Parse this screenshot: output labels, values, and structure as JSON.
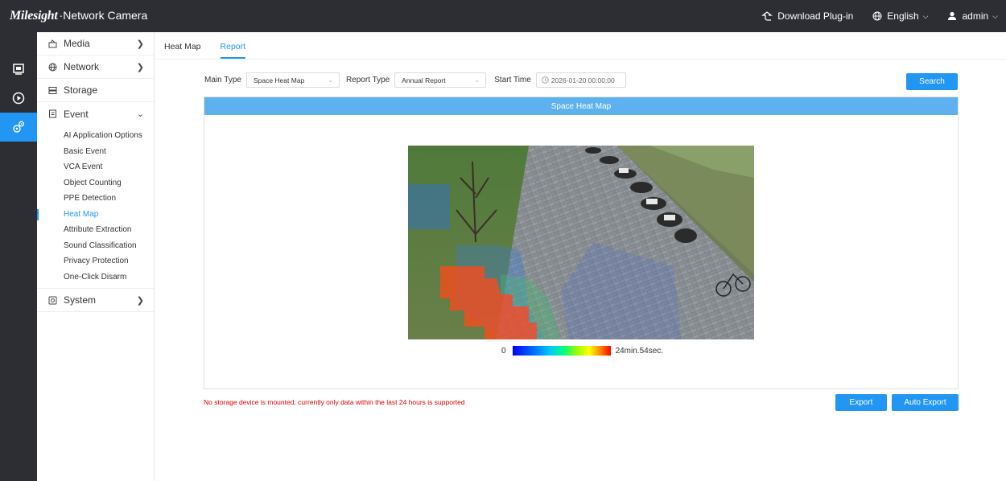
{
  "app": {
    "brand": "Milesight",
    "product": "Network Camera"
  },
  "topbar": {
    "download": "Download Plug-in",
    "language": "English",
    "user": "admin"
  },
  "rail": {
    "icons": [
      "live-view-icon",
      "playback-icon",
      "settings-icon"
    ]
  },
  "sidebar": {
    "media": "Media",
    "network": "Network",
    "storage": "Storage",
    "event": "Event",
    "event_items": [
      "AI Application Options",
      "Basic Event",
      "VCA Event",
      "Object Counting",
      "PPE Detection",
      "Heat Map",
      "Attribute Extraction",
      "Sound Classification",
      "Privacy Protection",
      "One-Click Disarm"
    ],
    "active_item": "Heat Map",
    "system": "System"
  },
  "tabs": [
    "Heat Map",
    "Report"
  ],
  "active_tab": "Report",
  "filters": {
    "main_type_label": "Main Type",
    "main_type_value": "Space Heat Map",
    "report_type_label": "Report Type",
    "report_type_value": "Annual Report",
    "start_time_label": "Start Time",
    "start_time_value": "2026-01-20 00:00:00",
    "search": "Search"
  },
  "panel": {
    "title": "Space Heat Map",
    "legend_min": "0",
    "legend_max": "24min.54sec."
  },
  "footer": {
    "warning": "No storage device is mounted, currently only data within the last 24 hours is supported",
    "export": "Export",
    "auto_export": "Auto Export"
  },
  "colors": {
    "accent": "#2196f3",
    "header": "#5cb1ee",
    "topbar": "#2d2e33",
    "warning": "#e00000"
  }
}
